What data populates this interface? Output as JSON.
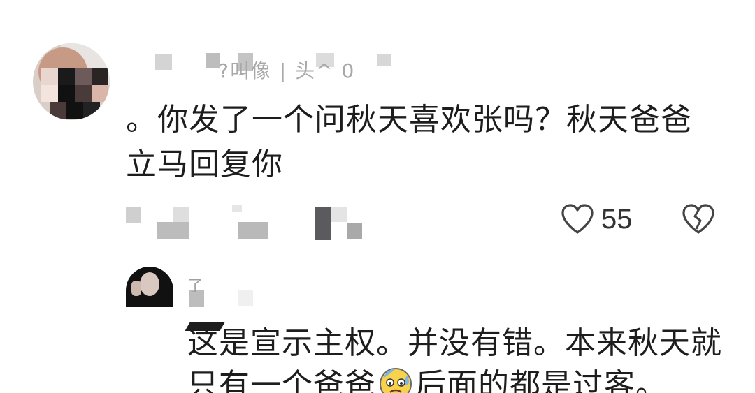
{
  "comment": {
    "username_fragment": "?叫像 | 头^ 0",
    "text": "。你发了一个问秋天喜欢张吗？秋天爸爸立马回复你",
    "like_count": "55"
  },
  "reply": {
    "username_fragment": "了",
    "text_before_emoji": "这是宣示主权。并没有错。本来秋天就只有一个爸爸",
    "emoji": "😰",
    "text_after_emoji": "后面的都是过客。"
  },
  "icons": {
    "like": "heart-outline-icon",
    "dislike": "broken-heart-icon"
  },
  "colors": {
    "text": "#1d1d1d",
    "icon": "#444444",
    "background": "#ffffff"
  }
}
